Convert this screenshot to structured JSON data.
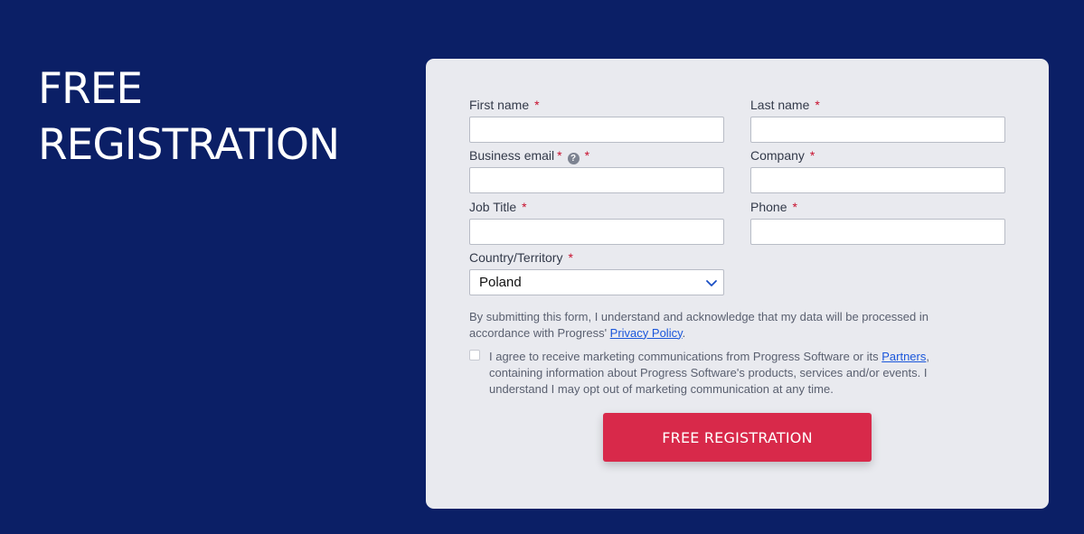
{
  "hero": {
    "title_line1": "FREE",
    "title_line2": "REGISTRATION"
  },
  "form": {
    "first_name": {
      "label": "First name",
      "required": "*",
      "value": ""
    },
    "last_name": {
      "label": "Last name",
      "required": "*",
      "value": ""
    },
    "business_email": {
      "label": "Business email",
      "required": "*",
      "help_icon": "?",
      "required2": "*",
      "value": ""
    },
    "company": {
      "label": "Company",
      "required": "*",
      "value": ""
    },
    "job_title": {
      "label": "Job Title",
      "required": "*",
      "value": ""
    },
    "phone": {
      "label": "Phone",
      "required": "*",
      "value": ""
    },
    "country": {
      "label": "Country/Territory",
      "required": "*",
      "selected": "Poland"
    },
    "consent": {
      "text_before": "By submitting this form, I understand and acknowledge that my data will be processed in accordance with Progress' ",
      "link": "Privacy Policy",
      "text_after": "."
    },
    "marketing": {
      "checked": false,
      "text_before": "I agree to receive marketing communications from Progress Software or its ",
      "link": "Partners",
      "text_after": ", containing information about Progress Software's products, services and/or events. I understand I may opt out of marketing communication at any time."
    },
    "submit_label": "FREE REGISTRATION"
  },
  "colors": {
    "background": "#0b1f66",
    "card": "#e9eaef",
    "submit": "#d8294a",
    "required": "#c8102e",
    "link": "#1a56db"
  }
}
